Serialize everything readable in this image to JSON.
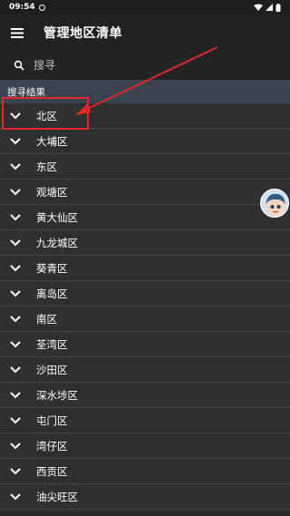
{
  "status": {
    "time": "09:54"
  },
  "app": {
    "title": "管理地区清单"
  },
  "search": {
    "placeholder": "搜寻"
  },
  "section": {
    "title": "搜寻结果"
  },
  "districts": [
    {
      "label": "北区"
    },
    {
      "label": "大埔区"
    },
    {
      "label": "东区"
    },
    {
      "label": "观塘区"
    },
    {
      "label": "黄大仙区"
    },
    {
      "label": "九龙城区"
    },
    {
      "label": "葵青区"
    },
    {
      "label": "离岛区"
    },
    {
      "label": "南区"
    },
    {
      "label": "荃湾区"
    },
    {
      "label": "沙田区"
    },
    {
      "label": "深水埗区"
    },
    {
      "label": "屯门区"
    },
    {
      "label": "湾仔区"
    },
    {
      "label": "西贡区"
    },
    {
      "label": "油尖旺区"
    }
  ],
  "colors": {
    "highlight": "#e5262c",
    "section_bg": "#3b4350",
    "list_bg": "#2f2f2f"
  },
  "icons": {
    "menu": "menu-icon",
    "search": "search-icon",
    "expand": "chevron-down-icon"
  }
}
